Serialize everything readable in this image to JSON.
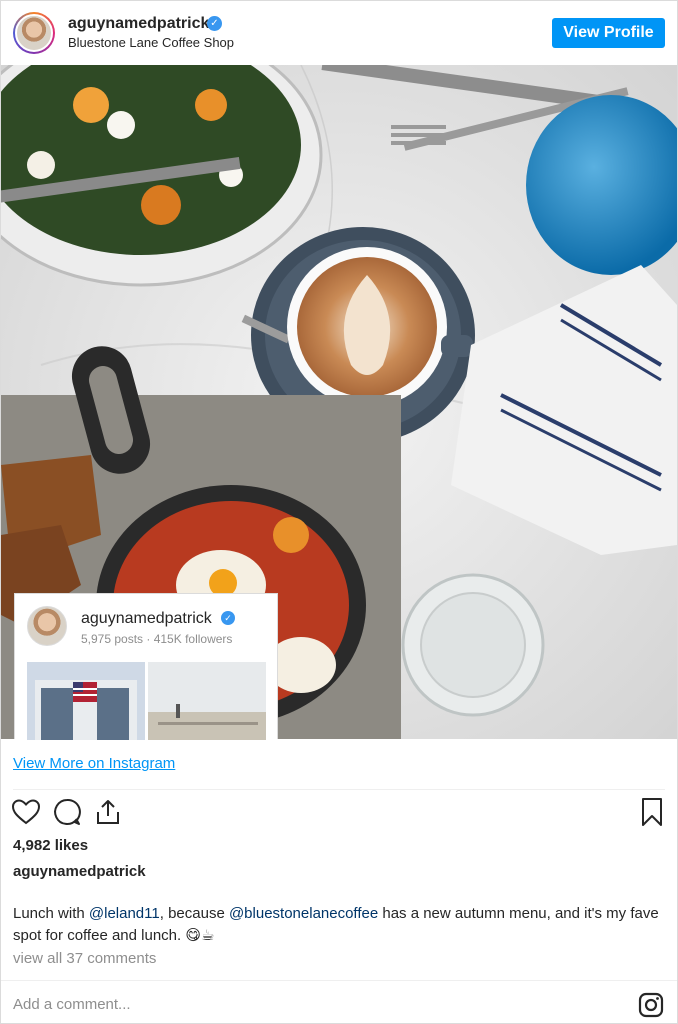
{
  "header": {
    "username": "aguynamedpatrick",
    "verified_mark": "✓",
    "location": "Bluestone Lane Coffee Shop",
    "view_profile_label": "View Profile"
  },
  "card": {
    "username": "aguynamedpatrick",
    "verified_mark": "✓",
    "stats": "5,975 posts · 415K followers"
  },
  "view_more_label": "View More on Instagram",
  "actions": {
    "like_icon": "heart-icon",
    "comment_icon": "comment-icon",
    "share_icon": "share-icon",
    "save_icon": "bookmark-icon"
  },
  "likes": "4,982 likes",
  "caption": {
    "username": "aguynamedpatrick",
    "part1": "Lunch with ",
    "mention1": "@leland11",
    "part2": ", because ",
    "mention2": "@bluestonelanecoffee",
    "part3": " has a new autumn menu, and it's my fave spot for coffee and lunch. 😋☕"
  },
  "comments_link": "view all 37 comments",
  "add_comment_placeholder": "Add a comment...",
  "colors": {
    "accent": "#0095f6",
    "verified": "#3897f0",
    "mention": "#003569"
  }
}
